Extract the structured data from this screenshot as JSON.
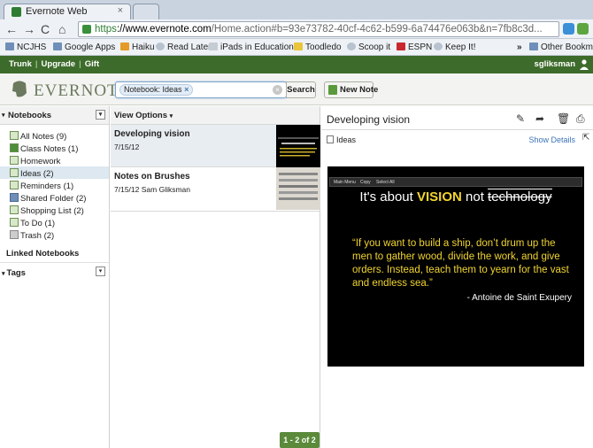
{
  "browser": {
    "tab_title": "Evernote Web",
    "tab_close": "×",
    "url_scheme": "https",
    "url_host": "://www.evernote.com",
    "url_path": "/Home.action#b=93e73782-40cf-4c62-b599-6a74476e063b&n=7fb8c3d...",
    "bookmarks": [
      "NCJHS",
      "Google Apps",
      "Haiku",
      "Read Later",
      "iPads in Education",
      "Toodledo",
      "Scoop it",
      "ESPN",
      "Keep It!"
    ],
    "bookmarks_more": "»",
    "other_bookmarks": "Other Bookmarks"
  },
  "topbar": {
    "links": [
      "Trunk",
      "Upgrade",
      "Gift"
    ],
    "user": "sgliksman"
  },
  "header": {
    "logo": "EVERNOTE",
    "search_chip": "Notebook: Ideas",
    "search_chip_x": "×",
    "search_button": "Search",
    "new_note": "New Note"
  },
  "sidebar": {
    "title": "Notebooks",
    "items": [
      {
        "label": "All Notes  (9)"
      },
      {
        "label": "Class Notes  (1)"
      },
      {
        "label": "Homework"
      },
      {
        "label": "Ideas  (2)"
      },
      {
        "label": "Reminders  (1)"
      },
      {
        "label": "Shared Folder  (2)"
      },
      {
        "label": "Shopping List  (2)"
      },
      {
        "label": "To Do  (1)"
      },
      {
        "label": "Trash  (2)"
      }
    ],
    "selected": "Ideas  (2)",
    "linked": "Linked Notebooks",
    "tags": "Tags"
  },
  "notelist": {
    "view_options": "View Options",
    "notes": [
      {
        "title": "Developing vision",
        "date": "7/15/12",
        "author": ""
      },
      {
        "title": "Notes on Brushes",
        "date": "7/15/12",
        "author": "Sam Gliksman"
      }
    ],
    "pager": "1 - 2 of 2"
  },
  "noteview": {
    "title": "Developing vision",
    "notebook": "Ideas",
    "show_details": "Show Details",
    "slide": {
      "toolbar": [
        "Main Menu",
        "Copy",
        "Select All"
      ],
      "headline_pre": "It's about ",
      "headline_vision": "VISION",
      "headline_mid": " not ",
      "headline_tech": "technology",
      "quote": "“If you want to build a ship, don’t drum up the men to gather wood, divide the work, and give orders. Instead, teach them to yearn for the vast and endless sea.”",
      "attribution": "- Antoine de Saint Exupery"
    }
  }
}
